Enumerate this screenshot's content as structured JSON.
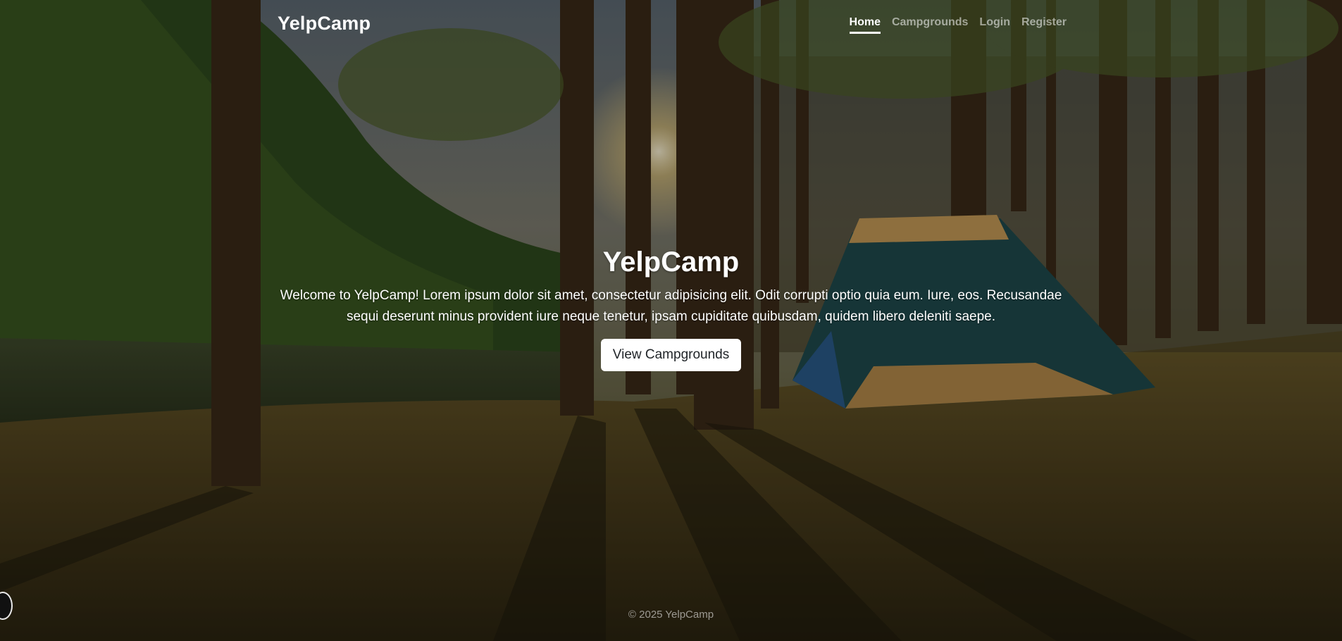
{
  "header": {
    "brand": "YelpCamp",
    "nav": [
      {
        "label": "Home",
        "active": true
      },
      {
        "label": "Campgrounds",
        "active": false
      },
      {
        "label": "Login",
        "active": false
      },
      {
        "label": "Register",
        "active": false
      }
    ]
  },
  "hero": {
    "title": "YelpCamp",
    "lead": "Welcome to YelpCamp! Lorem ipsum dolor sit amet, consectetur adipisicing elit. Odit corrupti optio quia eum. Iure, eos. Recusandae sequi deserunt minus provident iure neque tenetur, ipsam cupiditate quibusdam, quidem libero deleniti saepe.",
    "button_label": "View Campgrounds"
  },
  "footer": {
    "copyright": "© 2025 YelpCamp"
  },
  "colors": {
    "text": "#ffffff",
    "nav_inactive": "rgba(255,255,255,0.55)",
    "button_bg": "#ffffff",
    "button_text": "#212529"
  },
  "background": {
    "icon": "forest-campsite-background"
  }
}
